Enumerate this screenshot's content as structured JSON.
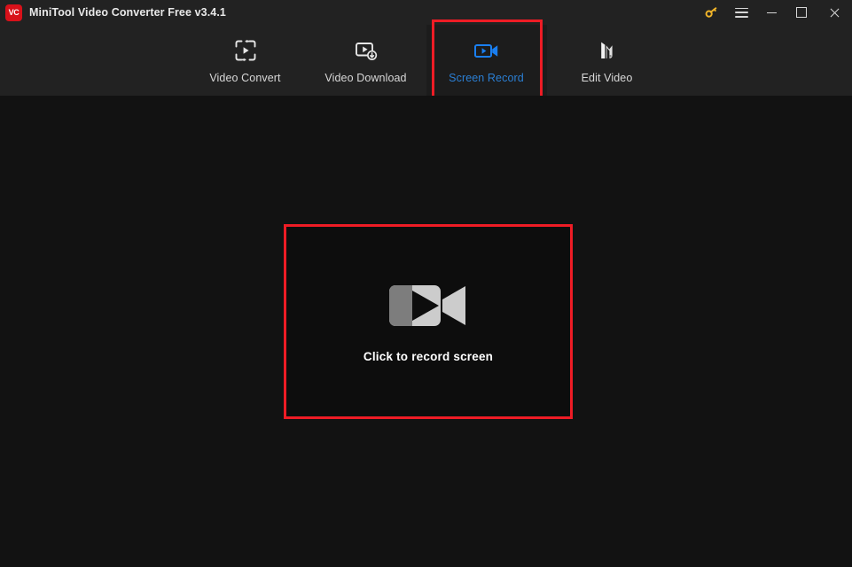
{
  "window": {
    "logo_text": "VC",
    "title": "MiniTool Video Converter Free v3.4.1",
    "controls": {
      "key_label": "key-activate",
      "menu_label": "menu",
      "minimize_label": "minimize",
      "maximize_label": "maximize",
      "close_label": "close"
    }
  },
  "nav": {
    "items": [
      {
        "label": "Video Convert",
        "icon": "video-convert-icon",
        "active": false
      },
      {
        "label": "Video Download",
        "icon": "video-download-icon",
        "active": false
      },
      {
        "label": "Screen Record",
        "icon": "screen-record-icon",
        "active": true
      },
      {
        "label": "Edit Video",
        "icon": "edit-video-icon",
        "active": false
      }
    ]
  },
  "main": {
    "record_caption": "Click to record screen",
    "record_icon": "camcorder-icon"
  },
  "colors": {
    "titlebar_bg": "#222222",
    "navbar_bg": "#222222",
    "stage_bg": "#121212",
    "active_tab_bg": "#1c1c1c",
    "accent_blue": "#2b7fd4",
    "icon_blue": "#1a7ff0",
    "highlight_red": "#ee1c25",
    "logo_red": "#d8111a",
    "key_gold": "#f0b429",
    "cam_light_gray": "#cccccc",
    "cam_dark_gray": "#7d7d7d",
    "text_primary": "#e9e9e9",
    "text_secondary": "#d8d8d8"
  }
}
